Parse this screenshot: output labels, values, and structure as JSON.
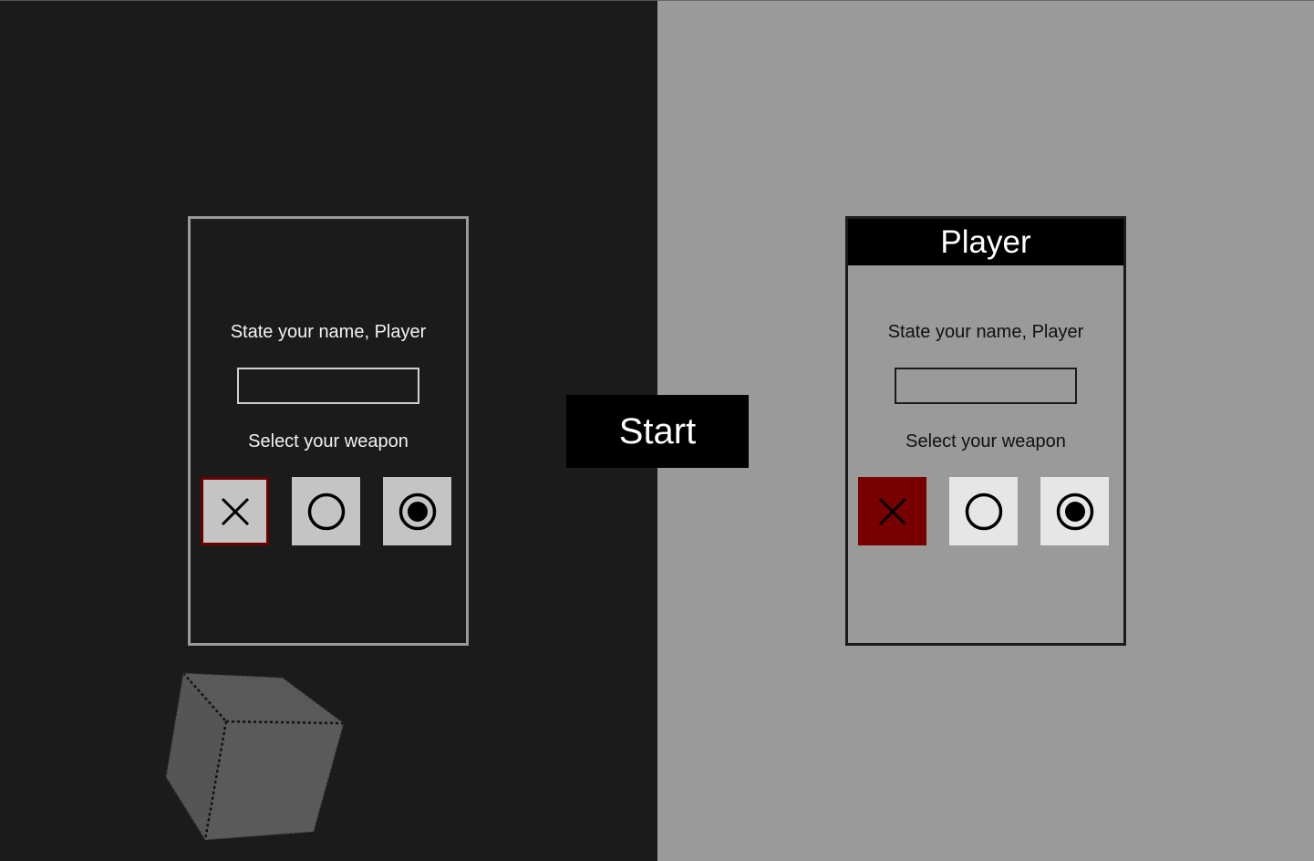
{
  "left_panel": {
    "name_prompt": "State your name, Player",
    "name_value": "",
    "weapon_prompt": "Select your weapon",
    "weapons": [
      {
        "icon": "x-icon",
        "selected": true
      },
      {
        "icon": "circle-icon",
        "selected": false
      },
      {
        "icon": "target-icon",
        "selected": false
      }
    ]
  },
  "start_label": "Start",
  "right_panel": {
    "header": "Player",
    "name_prompt": "State your name, Player",
    "name_value": "",
    "weapon_prompt": "Select your weapon",
    "weapons": [
      {
        "icon": "x-icon",
        "selected": true
      },
      {
        "icon": "circle-icon",
        "selected": false
      },
      {
        "icon": "target-icon",
        "selected": false
      }
    ]
  },
  "colors": {
    "left_background": "#1b1b1b",
    "right_background": "#9a9a9a",
    "selected_accent": "#780000",
    "start_button": "#000000"
  }
}
